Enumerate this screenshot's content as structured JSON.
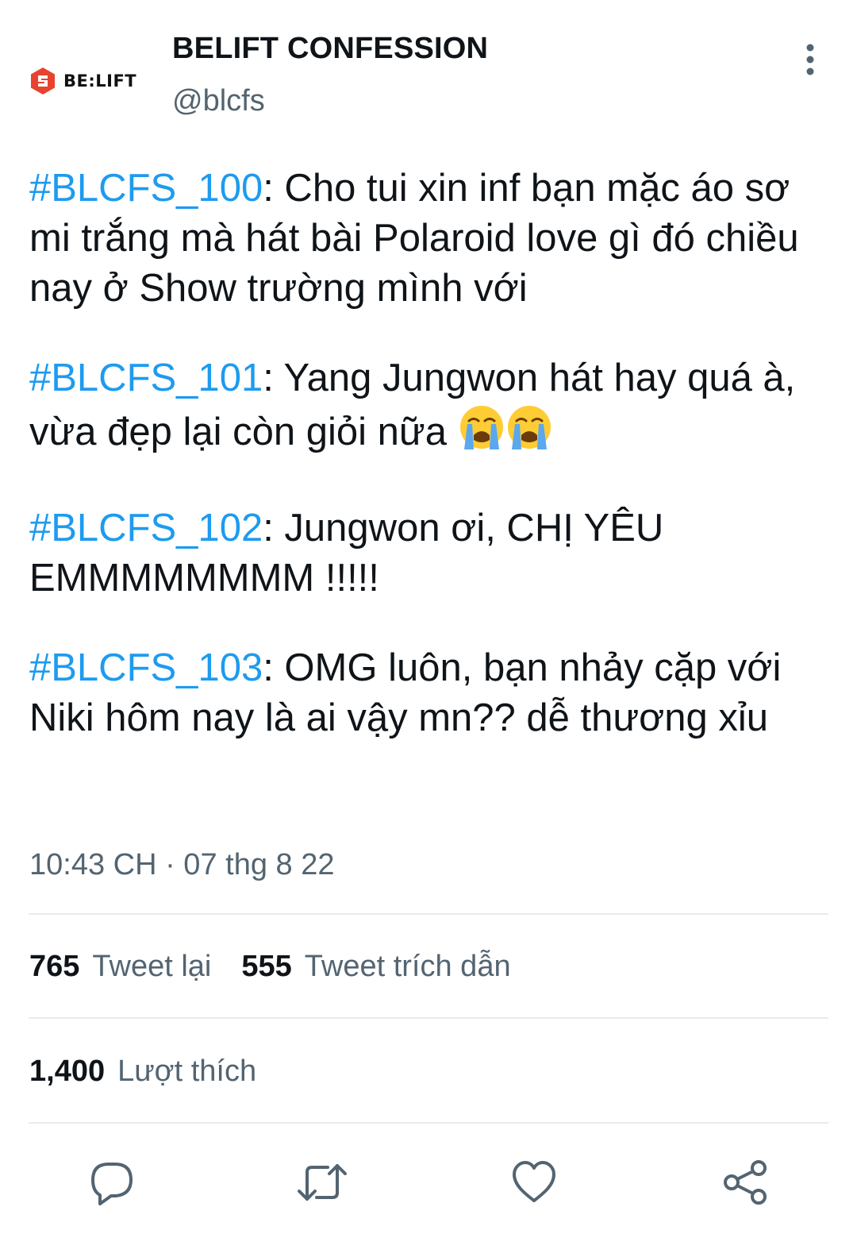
{
  "author": {
    "logo_text": "BE:LIFT",
    "display_name": "BELIFT CONFESSION",
    "handle": "@blcfs"
  },
  "tweet": {
    "paragraphs": [
      {
        "tag": "#BLCFS_100",
        "text": ": Cho tui xin inf bạn mặc áo sơ mi trắng mà hát bài Polaroid love gì đó chiều nay ở Show trường mình với"
      },
      {
        "tag": "#BLCFS_101",
        "text": ": Yang Jungwon hát hay quá à, vừa đẹp lại còn giỏi nữa",
        "emojis": [
          "loudly-crying-face",
          "loudly-crying-face"
        ]
      },
      {
        "tag": "#BLCFS_102",
        "text": ": Jungwon ơi, CHỊ YÊU EMMMMMMMM !!!!!"
      },
      {
        "tag": "#BLCFS_103",
        "text": ": OMG luôn, bạn nhảy cặp với Niki hôm nay là ai vậy mn?? dễ thương xỉu"
      }
    ],
    "timestamp": "10:43 CH · 07 thg 8 22"
  },
  "stats": {
    "retweets_count": "765",
    "retweets_label": "Tweet lại",
    "quotes_count": "555",
    "quotes_label": "Tweet trích dẫn",
    "likes_count": "1,400",
    "likes_label": "Lượt thích"
  },
  "actions": [
    {
      "icon": "reply-icon"
    },
    {
      "icon": "retweet-icon"
    },
    {
      "icon": "like-icon"
    },
    {
      "icon": "share-icon"
    }
  ],
  "colors": {
    "link": "#1d9bf0",
    "secondary_text": "#536471",
    "primary_text": "#0f1419",
    "divider": "#e6ecf0",
    "logo_red": "#e8432e"
  }
}
